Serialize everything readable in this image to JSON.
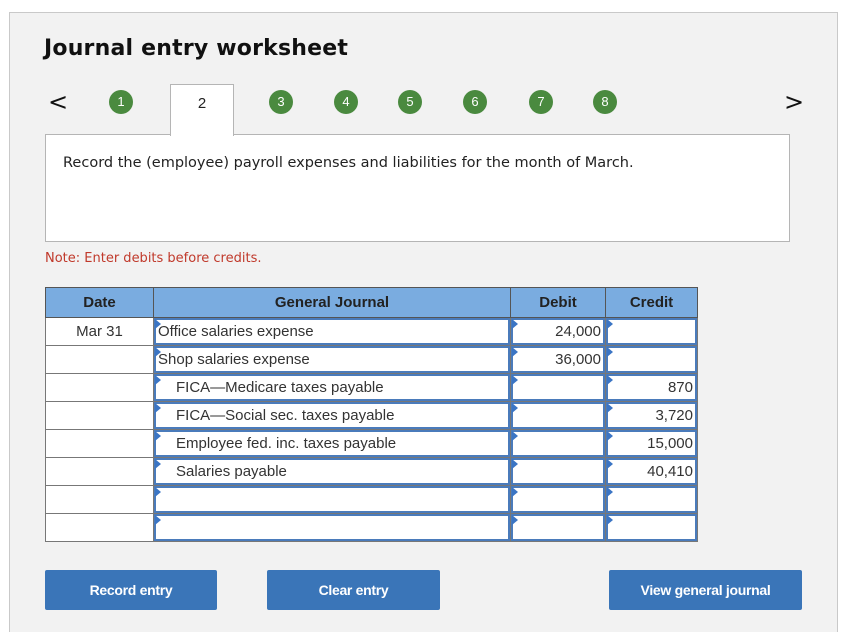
{
  "header": {
    "title": "Journal entry worksheet"
  },
  "stepper": {
    "prev_icon": "<",
    "next_icon": ">",
    "steps": [
      "1",
      "2",
      "3",
      "4",
      "5",
      "6",
      "7",
      "8"
    ],
    "active_step": "2"
  },
  "prompt": "Record the (employee) payroll expenses and liabilities for the month of March.",
  "note": "Note: Enter debits before credits.",
  "journal": {
    "columns": [
      "Date",
      "General Journal",
      "Debit",
      "Credit"
    ],
    "rows": [
      {
        "date": "Mar 31",
        "account": "Office salaries expense",
        "debit": "24,000",
        "credit": ""
      },
      {
        "date": "",
        "account": "Shop salaries expense",
        "debit": "36,000",
        "credit": ""
      },
      {
        "date": "",
        "account": "FICA—Medicare taxes payable",
        "debit": "",
        "credit": "870"
      },
      {
        "date": "",
        "account": "FICA—Social sec. taxes payable",
        "debit": "",
        "credit": "3,720"
      },
      {
        "date": "",
        "account": "Employee fed. inc. taxes payable",
        "debit": "",
        "credit": "15,000"
      },
      {
        "date": "",
        "account": "Salaries payable",
        "debit": "",
        "credit": "40,410"
      },
      {
        "date": "",
        "account": "",
        "debit": "",
        "credit": ""
      },
      {
        "date": "",
        "account": "",
        "debit": "",
        "credit": ""
      }
    ]
  },
  "buttons": {
    "record": "Record entry",
    "clear": "Clear entry",
    "view": "View general journal"
  },
  "colors": {
    "step_complete": "#4a8a3f",
    "table_header": "#7aace0",
    "button": "#3a75b8",
    "note": "#c0392b"
  }
}
